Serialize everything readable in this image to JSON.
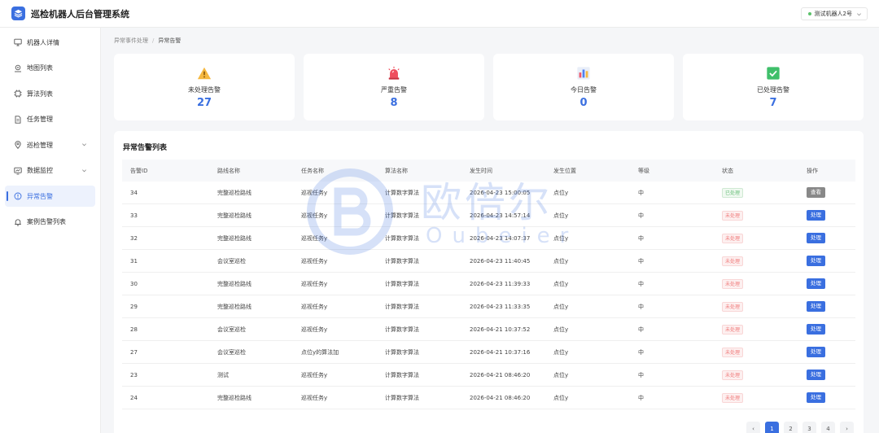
{
  "header": {
    "app_title": "巡检机器人后台管理系统",
    "robot_select": "测试机器人2号"
  },
  "sidebar": {
    "items": [
      {
        "label": "机器人详情",
        "icon": "monitor-icon"
      },
      {
        "label": "地图列表",
        "icon": "map-pin-icon"
      },
      {
        "label": "算法列表",
        "icon": "chip-icon"
      },
      {
        "label": "任务管理",
        "icon": "document-icon"
      },
      {
        "label": "巡检管理",
        "icon": "location-icon"
      },
      {
        "label": "数据监控",
        "icon": "chart-monitor-icon"
      },
      {
        "label": "异常告警",
        "icon": "alert-circle-icon"
      },
      {
        "label": "案例告警列表",
        "icon": "bell-icon"
      }
    ],
    "active": "异常告警"
  },
  "breadcrumb": {
    "parent": "异常事件处理",
    "separator": "/",
    "current": "异常告警"
  },
  "stats": [
    {
      "label": "未处理告警",
      "value": "27",
      "icon": "warning-triangle-icon"
    },
    {
      "label": "严重告警",
      "value": "8",
      "icon": "alarm-light-icon"
    },
    {
      "label": "今日告警",
      "value": "0",
      "icon": "bar-chart-icon"
    },
    {
      "label": "已处理告警",
      "value": "7",
      "icon": "check-box-icon"
    }
  ],
  "table": {
    "title": "异常告警列表",
    "columns": [
      "告警ID",
      "路线名称",
      "任务名称",
      "算法名称",
      "发生时间",
      "发生位置",
      "等级",
      "状态",
      "操作"
    ],
    "rows": [
      {
        "id": "34",
        "route": "完整巡检路线",
        "task": "巡视任务y",
        "algo": "计算数字算法",
        "time": "2026-04-23 15:00:05",
        "pos": "点位y",
        "level": "中",
        "status": "已处理",
        "action": "查看"
      },
      {
        "id": "33",
        "route": "完整巡检路线",
        "task": "巡视任务y",
        "algo": "计算数字算法",
        "time": "2026-04-23 14:57:14",
        "pos": "点位y",
        "level": "中",
        "status": "未处理",
        "action": "处理"
      },
      {
        "id": "32",
        "route": "完整巡检路线",
        "task": "巡视任务y",
        "algo": "计算数字算法",
        "time": "2026-04-23 14:07:37",
        "pos": "点位y",
        "level": "中",
        "status": "未处理",
        "action": "处理"
      },
      {
        "id": "31",
        "route": "会议室巡检",
        "task": "巡视任务y",
        "algo": "计算数字算法",
        "time": "2026-04-23 11:40:45",
        "pos": "点位y",
        "level": "中",
        "status": "未处理",
        "action": "处理"
      },
      {
        "id": "30",
        "route": "完整巡检路线",
        "task": "巡视任务y",
        "algo": "计算数字算法",
        "time": "2026-04-23 11:39:33",
        "pos": "点位y",
        "level": "中",
        "status": "未处理",
        "action": "处理"
      },
      {
        "id": "29",
        "route": "完整巡检路线",
        "task": "巡视任务y",
        "algo": "计算数字算法",
        "time": "2026-04-23 11:33:35",
        "pos": "点位y",
        "level": "中",
        "status": "未处理",
        "action": "处理"
      },
      {
        "id": "28",
        "route": "会议室巡检",
        "task": "巡视任务y",
        "algo": "计算数字算法",
        "time": "2026-04-21 10:37:52",
        "pos": "点位y",
        "level": "中",
        "status": "未处理",
        "action": "处理"
      },
      {
        "id": "27",
        "route": "会议室巡检",
        "task": "点位y的算法加",
        "algo": "计算数字算法",
        "time": "2026-04-21 10:37:16",
        "pos": "点位y",
        "level": "中",
        "status": "未处理",
        "action": "处理"
      },
      {
        "id": "23",
        "route": "测试",
        "task": "巡视任务y",
        "algo": "计算数字算法",
        "time": "2026-04-21 08:46:20",
        "pos": "点位y",
        "level": "中",
        "status": "未处理",
        "action": "处理"
      },
      {
        "id": "24",
        "route": "完整巡检路线",
        "task": "巡视任务y",
        "algo": "计算数字算法",
        "time": "2026-04-21 08:46:20",
        "pos": "点位y",
        "level": "中",
        "status": "未处理",
        "action": "处理"
      }
    ]
  },
  "pagination": {
    "prev": "‹",
    "pages": [
      "1",
      "2",
      "3",
      "4"
    ],
    "current": "1",
    "next": "›"
  },
  "watermark": {
    "text_cn": "欧倍尔",
    "text_en": "Oubeier"
  },
  "colors": {
    "accent": "#3a6fe0",
    "pending": "#f07b7b",
    "done": "#6cc07c",
    "view_button": "#888888"
  }
}
